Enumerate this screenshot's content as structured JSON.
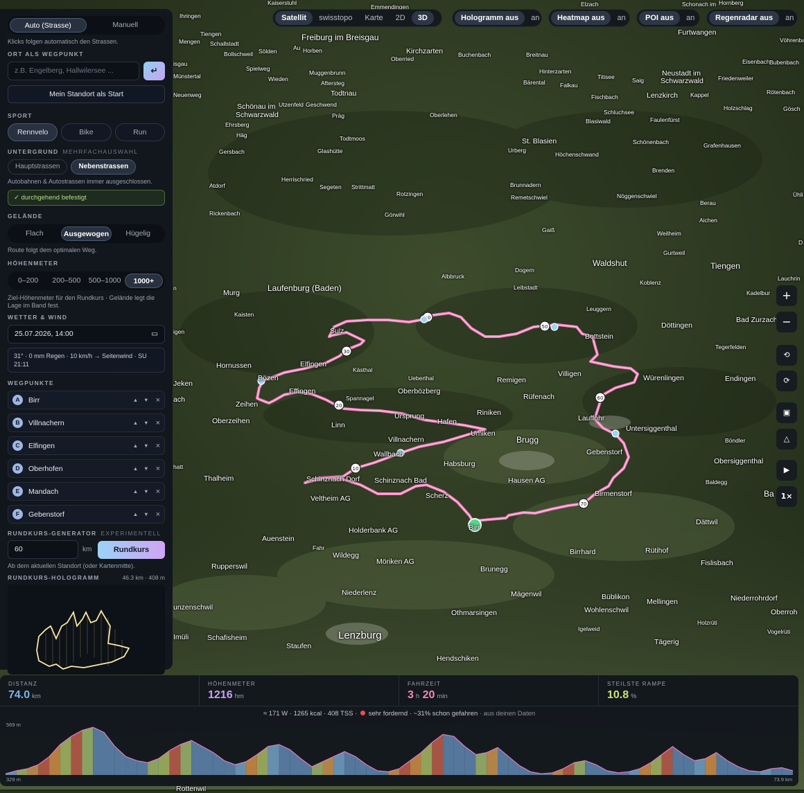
{
  "toolbar": {
    "layers": [
      "Satellit",
      "swisstopo",
      "Karte"
    ],
    "views": [
      "2D",
      "3D"
    ],
    "toggles": [
      {
        "label": "Hologramm aus",
        "on": "an"
      },
      {
        "label": "Heatmap aus",
        "on": "an"
      },
      {
        "label": "POI aus",
        "on": "an"
      },
      {
        "label": "Regenradar aus",
        "on": "an"
      }
    ]
  },
  "panel": {
    "mode": {
      "auto": "Auto (Strasse)",
      "manual": "Manuell"
    },
    "mode_hint": "Klicks folgen automatisch den Strassen.",
    "waypoint_section": "ORT ALS WEGPUNKT",
    "search_placeholder": "z.B. Engelberg, Hallwilersee ...",
    "enter_icon": "↵",
    "my_location": "Mein Standort als Start",
    "sport_section": "SPORT",
    "sports": [
      "Rennvelo",
      "Bike",
      "Run"
    ],
    "surface_section": "UNTERGRUND",
    "surface_sub": "MEHRFACHAUSWAHL",
    "surfaces": [
      "Hauptstrassen",
      "Nebenstrassen"
    ],
    "surface_hint": "Autobahnen & Autostrassen immer ausgeschlossen.",
    "paved": "✓ durchgehend befestigt",
    "terrain_section": "GELÄNDE",
    "terrains": [
      "Flach",
      "Ausgewogen",
      "Hügelig"
    ],
    "terrain_hint": "Route folgt dem optimalen Weg.",
    "elevation_section": "HÖHENMETER",
    "elevations": [
      "0–200",
      "200–500",
      "500–1000",
      "1000+"
    ],
    "elevation_hint": "Ziel-Höhenmeter für den Rundkurs · Gelände legt die Lage im Band fest.",
    "weather_section": "WETTER & WIND",
    "datetime": "25.07.2026, 14:00",
    "weather_line1": "31° · 0 mm Regen · 10 km/h → Seitenwind · SU",
    "weather_line2": "21:11",
    "waypoints_section": "WEGPUNKTE",
    "waypoints": [
      {
        "letter": "A",
        "name": "Birr"
      },
      {
        "letter": "B",
        "name": "Villnachern"
      },
      {
        "letter": "C",
        "name": "Elfingen"
      },
      {
        "letter": "D",
        "name": "Oberhofen"
      },
      {
        "letter": "E",
        "name": "Mandach"
      },
      {
        "letter": "F",
        "name": "Gebenstorf"
      }
    ],
    "wp_up": "▲",
    "wp_down": "▼",
    "wp_remove": "×",
    "generator_section": "RUNDKURS-GENERATOR",
    "generator_sub": "EXPERIMENTELL",
    "distance_value": "60",
    "distance_unit": "km",
    "generate_button": "Rundkurs",
    "generator_hint": "Ab dem aktuellen Standort (oder Kartenmitte).",
    "hologram_section": "RUNDKURS-HOLOGRAMM",
    "hologram_meta": "46.3 km · 408 m"
  },
  "controls": {
    "zoom_in": "+",
    "zoom_out": "−",
    "speed": "1×"
  },
  "stats": {
    "distance": {
      "label": "DISTANZ",
      "value": "74.0",
      "unit": "km",
      "color": "#7fb2f0"
    },
    "elevation": {
      "label": "HÖHENMETER",
      "value": "1216",
      "unit": "hm",
      "color": "#c9a2f2"
    },
    "time": {
      "label": "FAHRZEIT",
      "h": "3",
      "h_unit": "h",
      "min": "20",
      "min_unit": "min",
      "color": "#f08bb5"
    },
    "ramp": {
      "label": "STEILSTE RAMPE",
      "value": "10.8",
      "unit": "%",
      "color": "#c8e27a"
    },
    "summary_a": "≈ 171 W · 1265 kcal · 408 TSS ·",
    "summary_b": "sehr fordernd · ~31% schon gefahren",
    "summary_c": "· aus deinen Daten",
    "profile_max": "569 m",
    "profile_min": "329 m",
    "profile_end": "73.9 km"
  },
  "profile": {
    "elevations_m": [
      335,
      350,
      360,
      380,
      420,
      480,
      520,
      550,
      565,
      540,
      470,
      420,
      400,
      390,
      410,
      450,
      480,
      500,
      470,
      440,
      400,
      380,
      395,
      430,
      470,
      480,
      455,
      410,
      370,
      395,
      420,
      445,
      420,
      380,
      350,
      345,
      360,
      400,
      440,
      490,
      530,
      520,
      470,
      430,
      440,
      465,
      420,
      375,
      345,
      335,
      340,
      360,
      390,
      400,
      380,
      350,
      340,
      345,
      360,
      390,
      430,
      470,
      430,
      400,
      410,
      440,
      400,
      370,
      350,
      345,
      360,
      365,
      350
    ]
  },
  "route_markers": [
    "10",
    "20",
    "30",
    "40",
    "50",
    "60",
    "70"
  ],
  "map_labels": [
    {
      "t": "Freiburg im Breisgau",
      "s": "l"
    },
    {
      "t": "Kirchzarten",
      "s": "m"
    },
    {
      "t": "Oberried",
      "s": "s"
    },
    {
      "t": "Buchenbach",
      "s": "s"
    },
    {
      "t": "Breitnau",
      "s": "s"
    },
    {
      "t": "Hinterzarten",
      "s": "s"
    },
    {
      "t": "Titisee",
      "s": "s"
    },
    {
      "t": "Neustadt im",
      "s": "m"
    },
    {
      "t": "Schwarzwald",
      "s": "m"
    },
    {
      "t": "Friedenweiler",
      "s": "s"
    },
    {
      "t": "Eisenbach",
      "s": "s"
    },
    {
      "t": "Bubenbach",
      "s": "s"
    },
    {
      "t": "Vöhrenbach",
      "s": "s"
    },
    {
      "t": "Furtwangen",
      "s": "m"
    },
    {
      "t": "Ihringen",
      "s": "s"
    },
    {
      "t": "Tiengen",
      "s": "s"
    },
    {
      "t": "Mengen",
      "s": "s"
    },
    {
      "t": "Schallstadt",
      "s": "s"
    },
    {
      "t": "Bollschweil",
      "s": "s"
    },
    {
      "t": "Sölden",
      "s": "s"
    },
    {
      "t": "Au",
      "s": "s"
    },
    {
      "t": "Horben",
      "s": "s"
    },
    {
      "t": "Spielweg",
      "s": "s"
    },
    {
      "t": "Muggenbrunn",
      "s": "s"
    },
    {
      "t": "Aftersteg",
      "s": "s"
    },
    {
      "t": "Todtnau",
      "s": "m"
    },
    {
      "t": "Wieden",
      "s": "s"
    },
    {
      "t": "Münstertal",
      "s": "s"
    },
    {
      "t": "Neuenweg",
      "s": "s"
    },
    {
      "t": "Schönau im",
      "s": "m"
    },
    {
      "t": "Schwarzwald",
      "s": "m"
    },
    {
      "t": "Utzenfeld",
      "s": "s"
    },
    {
      "t": "Geschwend",
      "s": "s"
    },
    {
      "t": "Präg",
      "s": "s"
    },
    {
      "t": "Oberlehen",
      "s": "s"
    },
    {
      "t": "Bärental",
      "s": "s"
    },
    {
      "t": "Falkau",
      "s": "s"
    },
    {
      "t": "Saig",
      "s": "s"
    },
    {
      "t": "Lenzkirch",
      "s": "m"
    },
    {
      "t": "Kappel",
      "s": "s"
    },
    {
      "t": "Rötenbach",
      "s": "s"
    },
    {
      "t": "Gösch",
      "s": "s"
    },
    {
      "t": "Fischbach",
      "s": "s"
    },
    {
      "t": "Schluchsee",
      "s": "s"
    },
    {
      "t": "Blasiwald",
      "s": "s"
    },
    {
      "t": "Faulenfürst",
      "s": "s"
    },
    {
      "t": "Holzschlag",
      "s": "s"
    },
    {
      "t": "Ehrsberg",
      "s": "s"
    },
    {
      "t": "Häg",
      "s": "s"
    },
    {
      "t": "Gersbach",
      "s": "s"
    },
    {
      "t": "Todtmoos",
      "s": "s"
    },
    {
      "t": "Glashütte",
      "s": "s"
    },
    {
      "t": "St. Blasien",
      "s": "m"
    },
    {
      "t": "Urberg",
      "s": "s"
    },
    {
      "t": "Höchenschwand",
      "s": "s"
    },
    {
      "t": "Schönenbach",
      "s": "s"
    },
    {
      "t": "Grafenhausen",
      "s": "s"
    },
    {
      "t": "Brenden",
      "s": "s"
    },
    {
      "t": "Herrischried",
      "s": "s"
    },
    {
      "t": "Segeten",
      "s": "s"
    },
    {
      "t": "Strittmatt",
      "s": "s"
    },
    {
      "t": "Atdorf",
      "s": "s"
    },
    {
      "t": "Rotzingen",
      "s": "s"
    },
    {
      "t": "Brunnadern",
      "s": "s"
    },
    {
      "t": "Remetschwiel",
      "s": "s"
    },
    {
      "t": "Nöggenschwiel",
      "s": "s"
    },
    {
      "t": "Berau",
      "s": "s"
    },
    {
      "t": "Ühli",
      "s": "s"
    },
    {
      "t": "Rickenbach",
      "s": "s"
    },
    {
      "t": "Görwihl",
      "s": "s"
    },
    {
      "t": "Aichen",
      "s": "s"
    },
    {
      "t": "Gaiß",
      "s": "s"
    },
    {
      "t": "Weilheim",
      "s": "s"
    },
    {
      "t": "D",
      "s": "s"
    },
    {
      "t": "Gurtweil",
      "s": "s"
    },
    {
      "t": "Waldshut",
      "s": "l"
    },
    {
      "t": "Tiengen",
      "s": "l"
    },
    {
      "t": "Lauchrin",
      "s": "s"
    },
    {
      "t": "Albbruck",
      "s": "s"
    },
    {
      "t": "Dogern",
      "s": "s"
    },
    {
      "t": "Leibstadt",
      "s": "s"
    },
    {
      "t": "Koblenz",
      "s": "s"
    },
    {
      "t": "Laufenburg (Baden)",
      "s": "l"
    },
    {
      "t": "Murg",
      "s": "m"
    },
    {
      "t": "Kadelbur",
      "s": "s"
    },
    {
      "t": "Leuggern",
      "s": "s"
    },
    {
      "t": "Kaisten",
      "s": "s"
    },
    {
      "t": "Bad Zurzach",
      "s": "m"
    },
    {
      "t": "Döttingen",
      "s": "m"
    },
    {
      "t": "Sulz",
      "s": "m"
    },
    {
      "t": "Bottstein",
      "s": "m"
    },
    {
      "t": "Tegerfelden",
      "s": "s"
    },
    {
      "t": "Elfingen",
      "s": "m"
    },
    {
      "t": "Hornussen",
      "s": "m"
    },
    {
      "t": "Kästhal",
      "s": "s"
    },
    {
      "t": "Villigen",
      "s": "m"
    },
    {
      "t": "Würenlingen",
      "s": "m"
    },
    {
      "t": "Endingen",
      "s": "m"
    },
    {
      "t": "Bözen",
      "s": "m"
    },
    {
      "t": "Ueberthal",
      "s": "s"
    },
    {
      "t": "Remigen",
      "s": "m"
    },
    {
      "t": "Effingen",
      "s": "m"
    },
    {
      "t": "Oberbözberg",
      "s": "m"
    },
    {
      "t": "Rüfenach",
      "s": "m"
    },
    {
      "t": "Spannagel",
      "s": "s"
    },
    {
      "t": "Zeihen",
      "s": "m"
    },
    {
      "t": "Oberzeihen",
      "s": "m"
    },
    {
      "t": "Ursprung",
      "s": "m"
    },
    {
      "t": "Riniken",
      "s": "m"
    },
    {
      "t": "Lauffohr",
      "s": "m"
    },
    {
      "t": "Linn",
      "s": "m"
    },
    {
      "t": "Hafen",
      "s": "m"
    },
    {
      "t": "Untersiggenthal",
      "s": "m"
    },
    {
      "t": "Umiken",
      "s": "m"
    },
    {
      "t": "Brugg",
      "s": "l"
    },
    {
      "t": "Böndler",
      "s": "s"
    },
    {
      "t": "Villnachern",
      "s": "m"
    },
    {
      "t": "Gebenstorf",
      "s": "m"
    },
    {
      "t": "Wallbach",
      "s": "m"
    },
    {
      "t": "Obersiggenthal",
      "s": "m"
    },
    {
      "t": "Habsburg",
      "s": "m"
    },
    {
      "t": "Thalheim",
      "s": "m"
    },
    {
      "t": "Schinznach Dorf",
      "s": "m"
    },
    {
      "t": "Schinznach Bad",
      "s": "m"
    },
    {
      "t": "Hausen AG",
      "s": "m"
    },
    {
      "t": "Baldegg",
      "s": "s"
    },
    {
      "t": "Scherz",
      "s": "m"
    },
    {
      "t": "Birmenstorf",
      "s": "m"
    },
    {
      "t": "Veltheim AG",
      "s": "m"
    },
    {
      "t": "Ba",
      "s": "l"
    },
    {
      "t": "Holderbank AG",
      "s": "m"
    },
    {
      "t": "Dättwil",
      "s": "m"
    },
    {
      "t": "Auenstein",
      "s": "m"
    },
    {
      "t": "Fahr",
      "s": "s"
    },
    {
      "t": "Wildegg",
      "s": "m"
    },
    {
      "t": "Birrhard",
      "s": "m"
    },
    {
      "t": "Rütihof",
      "s": "m"
    },
    {
      "t": "Fislisbach",
      "s": "m"
    },
    {
      "t": "Möriken AG",
      "s": "m"
    },
    {
      "t": "Brunegg",
      "s": "m"
    },
    {
      "t": "Rupperswil",
      "s": "m"
    },
    {
      "t": "Niederlenz",
      "s": "m"
    },
    {
      "t": "Mägenwil",
      "s": "m"
    },
    {
      "t": "Büblikon",
      "s": "m"
    },
    {
      "t": "Niederrohrdorf",
      "s": "m"
    },
    {
      "t": "Oberroh",
      "s": "m"
    },
    {
      "t": "Wohlenschwil",
      "s": "m"
    },
    {
      "t": "Mellingen",
      "s": "m"
    },
    {
      "t": "Othmarsingen",
      "s": "m"
    },
    {
      "t": "unzenschwil",
      "s": "m"
    },
    {
      "t": "Holzrüti",
      "s": "s"
    },
    {
      "t": "Vogelrüti",
      "s": "s"
    },
    {
      "t": "Igelweid",
      "s": "s"
    },
    {
      "t": "Lenzburg",
      "s": "xl"
    },
    {
      "t": "Schafisheim",
      "s": "m"
    },
    {
      "t": "Imüli",
      "s": "m"
    },
    {
      "t": "Staufen",
      "s": "m"
    },
    {
      "t": "Tägerig",
      "s": "m"
    },
    {
      "t": "Hendschiken",
      "s": "m"
    },
    {
      "t": "Rottenwil",
      "s": "m"
    },
    {
      "t": "Kaiserstuhl",
      "s": "s"
    },
    {
      "t": "Emmendingen",
      "s": "s"
    },
    {
      "t": "Elzach",
      "s": "s"
    },
    {
      "t": "Schonach im",
      "s": "s"
    },
    {
      "t": "Hornberg",
      "s": "s"
    },
    {
      "t": "isgau",
      "s": "s"
    },
    {
      "t": "n",
      "s": "s"
    },
    {
      "t": "igen",
      "s": "s"
    },
    {
      "t": "Jeken",
      "s": "m"
    },
    {
      "t": "ach",
      "s": "m"
    },
    {
      "t": "hatt",
      "s": "s"
    },
    {
      "t": "Birr",
      "s": "m"
    }
  ]
}
